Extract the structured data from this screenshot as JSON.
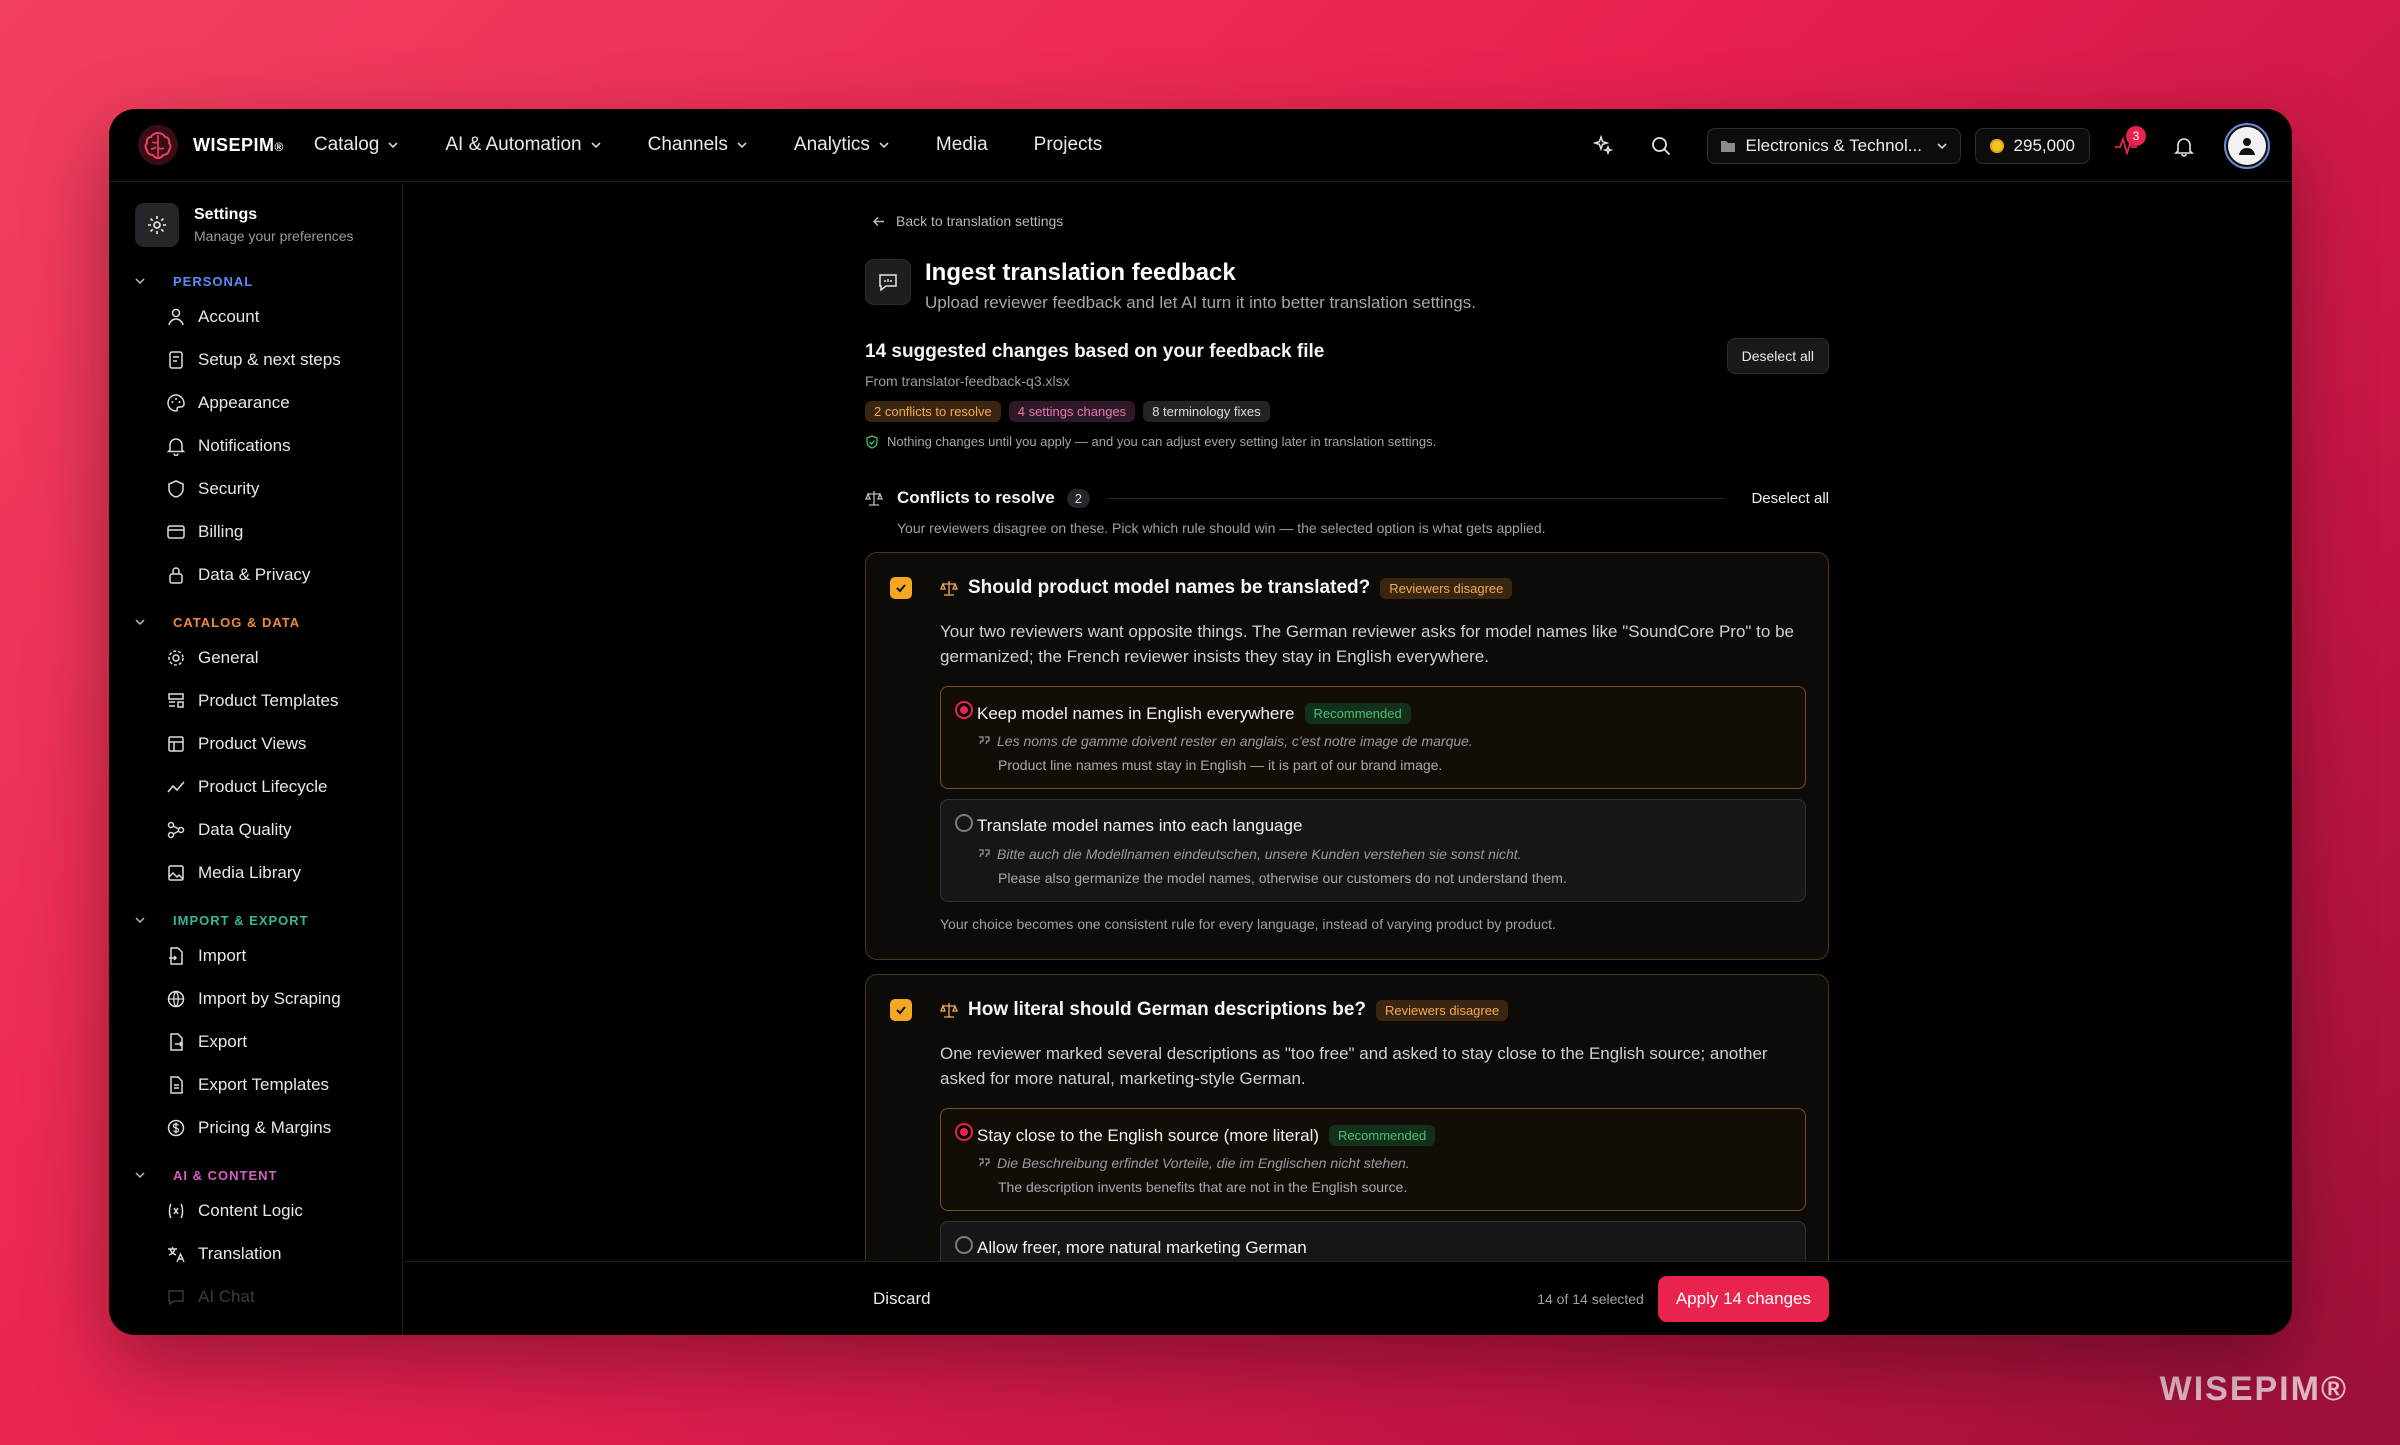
{
  "brand": {
    "name": "WISEPIM",
    "mark": "®"
  },
  "watermark": "WISEPIM®",
  "nav": [
    {
      "label": "Catalog",
      "has_menu": true
    },
    {
      "label": "AI & Automation",
      "has_menu": true
    },
    {
      "label": "Channels",
      "has_menu": true
    },
    {
      "label": "Analytics",
      "has_menu": true
    },
    {
      "label": "Media",
      "has_menu": false
    },
    {
      "label": "Projects",
      "has_menu": false
    }
  ],
  "topbar": {
    "workspace": "Electronics & Technol...",
    "credits": "295,000",
    "activity_badge": "3"
  },
  "sidebar": {
    "title": "Settings",
    "subtitle": "Manage your preferences",
    "sections": [
      {
        "label": "PERSONAL",
        "color": "#5b8cf5",
        "items": [
          "Account",
          "Setup & next steps",
          "Appearance",
          "Notifications",
          "Security",
          "Billing",
          "Data & Privacy"
        ]
      },
      {
        "label": "CATALOG & DATA",
        "color": "#ef8a3c",
        "items": [
          "General",
          "Product Templates",
          "Product Views",
          "Product Lifecycle",
          "Data Quality",
          "Media Library"
        ]
      },
      {
        "label": "IMPORT & EXPORT",
        "color": "#35b79a",
        "items": [
          "Import",
          "Import by Scraping",
          "Export",
          "Export Templates",
          "Pricing & Margins"
        ]
      },
      {
        "label": "AI & CONTENT",
        "color": "#d55fc2",
        "items": [
          "Content Logic",
          "Translation",
          "AI Chat"
        ]
      }
    ]
  },
  "page": {
    "back_label": "Back to translation settings",
    "title": "Ingest translation feedback",
    "subtitle": "Upload reviewer feedback and let AI turn it into better translation settings."
  },
  "summary": {
    "title": "14 suggested changes based on your feedback file",
    "source": "From translator-feedback-q3.xlsx",
    "pills": [
      "2 conflicts to resolve",
      "4 settings changes",
      "8 terminology fixes"
    ],
    "note": "Nothing changes until you apply — and you can adjust every setting later in translation settings.",
    "deselect_label": "Deselect all"
  },
  "conflicts": {
    "title": "Conflicts to resolve",
    "count": "2",
    "deselect_label": "Deselect all",
    "description": "Your reviewers disagree on these. Pick which rule should win — the selected option is what gets applied.",
    "cards": [
      {
        "title": "Should product model names be translated?",
        "badge": "Reviewers disagree",
        "description": "Your two reviewers want opposite things. The German reviewer asks for model names like \"SoundCore Pro\" to be germanized; the French reviewer insists they stay in English everywhere.",
        "options": [
          {
            "title": "Keep model names in English everywhere",
            "recommended": "Recommended",
            "quote": "Les noms de gamme doivent rester en anglais, c'est notre image de marque.",
            "translation": "Product line names must stay in English — it is part of our brand image.",
            "selected": true
          },
          {
            "title": "Translate model names into each language",
            "quote": "Bitte auch die Modellnamen eindeutschen, unsere Kunden verstehen sie sonst nicht.",
            "translation": "Please also germanize the model names, otherwise our customers do not understand them.",
            "selected": false
          }
        ],
        "footer": "Your choice becomes one consistent rule for every language, instead of varying product by product."
      },
      {
        "title": "How literal should German descriptions be?",
        "badge": "Reviewers disagree",
        "description": "One reviewer marked several descriptions as \"too free\" and asked to stay close to the English source; another asked for more natural, marketing-style German.",
        "options": [
          {
            "title": "Stay close to the English source (more literal)",
            "recommended": "Recommended",
            "quote": "Die Beschreibung erfindet Vorteile, die im Englischen nicht stehen.",
            "translation": "The description invents benefits that are not in the English source.",
            "selected": true
          },
          {
            "title": "Allow freer, more natural marketing German",
            "selected": false
          }
        ]
      }
    ]
  },
  "actions": {
    "discard": "Discard",
    "selected": "14 of 14 selected",
    "apply": "Apply 14 changes"
  },
  "colors": {
    "accent": "#e8234d",
    "warning": "#f5a623",
    "success": "#49c06f"
  }
}
